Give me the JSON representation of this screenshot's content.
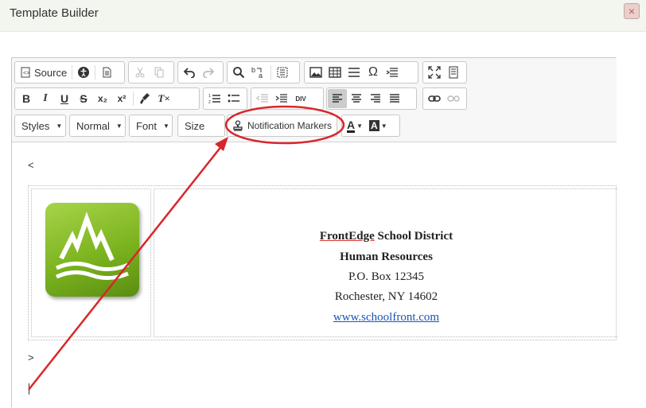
{
  "window": {
    "title": "Template Builder",
    "close_label": "×"
  },
  "toolbar": {
    "source_label": "Source",
    "styles_label": "Styles",
    "format_label": "Normal",
    "font_label": "Font",
    "size_label": "Size",
    "notification_markers_label": "Notification Markers",
    "symbols": {
      "bold": "B",
      "italic": "I",
      "underline": "U",
      "strike": "S",
      "subscript": "x₂",
      "superscript": "x²",
      "clear_format": "T×",
      "omega": "Ω",
      "div": "DIV",
      "text_color": "A",
      "bg_color": "A"
    }
  },
  "content": {
    "lt_marker": "<",
    "gt_marker": ">",
    "org_name_part1": "FrontEdge",
    "org_name_part2": " School District",
    "department": "Human Resources",
    "po_box": "P.O. Box 12345",
    "city_state": "Rochester, NY 14602",
    "website": "www.schoolfront.com"
  },
  "annotation_color": "#d9262b"
}
